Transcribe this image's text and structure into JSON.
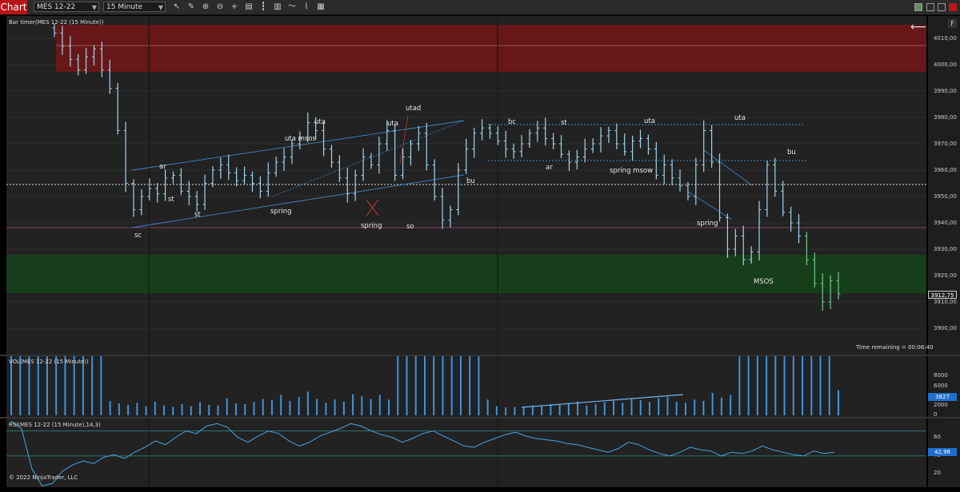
{
  "toolbar": {
    "chart_tab": "Chart",
    "instrument": "MES 12-22",
    "interval": "15 Minute",
    "icons": [
      "pointer-icon",
      "line-draw-icon",
      "zoom-in-icon",
      "zoom-out-icon",
      "crosshair-icon",
      "properties-icon",
      "chart-style-icon",
      "data-series-icon",
      "indicators-icon",
      "strategies-icon",
      "drawing-tools-icon"
    ]
  },
  "price_panel": {
    "title": "Bar timer(MES 12-22 (15 Minute))",
    "axis_labels": [
      "4010,00",
      "4000,00",
      "3990,00",
      "3980,00",
      "3970,00",
      "3960,00",
      "3950,00",
      "3940,00",
      "3930,00",
      "3920,00",
      "3910,00",
      "3900,00"
    ],
    "current_price": "3912,75",
    "time_remaining": "Time remaining = 00:06:40",
    "annotations": [
      "ar",
      "st",
      "st",
      "sc",
      "spring",
      "uta",
      "uta msos",
      "utad",
      "uta",
      "spring",
      "so",
      "bu",
      "bc",
      "st",
      "ar",
      "uta",
      "spring msow",
      "uta",
      "spring",
      "bu",
      "MSOS"
    ]
  },
  "volume_panel": {
    "title": "VOL(MES 12-22 (15 Minute))",
    "axis_labels": [
      "8000",
      "6000",
      "4000",
      "2000",
      "0"
    ],
    "current_value": "3827"
  },
  "rsi_panel": {
    "title": "RSI(MES 12-22 (15 Minute),14,3)",
    "axis_labels": [
      "60",
      "40",
      "20"
    ],
    "current_value": "42,98"
  },
  "footer": {
    "copyright": "© 2022 NinjaTrader, LLC"
  },
  "colors": {
    "supply_zone": "#6b1718",
    "demand_zone": "#16401b",
    "bar": "#9fd6ee",
    "volume": "#3a95e3",
    "rsi_line": "#4aa3df",
    "accent_red": "#b8141a"
  },
  "chart_data": {
    "type": "candlestick",
    "y_range": [
      3900,
      4015
    ],
    "close_trail": [
      4012,
      4007,
      4002,
      3998,
      4003,
      4006,
      3998,
      3991,
      3975,
      3955,
      3945,
      3950,
      3953,
      3951,
      3957,
      3958,
      3952,
      3950,
      3947,
      3955,
      3960,
      3962,
      3959,
      3956,
      3958,
      3955,
      3952,
      3959,
      3963,
      3965,
      3970,
      3972,
      3978,
      3975,
      3968,
      3963,
      3957,
      3951,
      3958,
      3965,
      3962,
      3970,
      3975,
      3958,
      3965,
      3970,
      3974,
      3962,
      3950,
      3941,
      3945,
      3960,
      3968,
      3974,
      3976,
      3974,
      3971,
      3968,
      3967,
      3970,
      3974,
      3976,
      3972,
      3970,
      3966,
      3963,
      3965,
      3968,
      3970,
      3973,
      3975,
      3970,
      3967,
      3971,
      3972,
      3968,
      3958,
      3962,
      3957,
      3954,
      3950,
      3962,
      3975,
      3963,
      3942,
      3930,
      3935,
      3926,
      3929,
      3945,
      3962,
      3952,
      3944,
      3940,
      3935,
      3926,
      3917,
      3910,
      3918,
      3913
    ],
    "volume": [
      9000,
      9000,
      9000,
      9000,
      9000,
      9000,
      9000,
      9000,
      9000,
      9000,
      9000,
      2200,
      1800,
      1600,
      1900,
      1400,
      2100,
      1500,
      1300,
      1700,
      1400,
      2000,
      1600,
      1500,
      2600,
      1800,
      1700,
      2000,
      2500,
      2300,
      3100,
      2200,
      2800,
      3600,
      2500,
      1900,
      2400,
      2100,
      3200,
      2900,
      2500,
      3100,
      2400,
      9000,
      9000,
      9000,
      9000,
      9000,
      9000,
      9000,
      9000,
      9000,
      9000,
      2400,
      1400,
      1200,
      1300,
      1200,
      1500,
      1400,
      1700,
      1600,
      1800,
      2100,
      1500,
      1700,
      2000,
      2200,
      1900,
      2500,
      2300,
      2000,
      2600,
      2800,
      2100,
      1900,
      2400,
      2200,
      3400,
      2700,
      3100,
      9000,
      9000,
      9000,
      9000,
      9000,
      9000,
      9000,
      9000,
      9000,
      9000,
      9000,
      3827
    ],
    "rsi_range": [
      15,
      70
    ],
    "rsi": [
      68,
      62,
      30,
      16,
      18,
      28,
      33,
      36,
      34,
      39,
      41,
      38,
      43,
      47,
      52,
      49,
      55,
      60,
      58,
      64,
      66,
      63,
      55,
      51,
      56,
      60,
      58,
      52,
      48,
      51,
      56,
      59,
      62,
      66,
      64,
      60,
      57,
      55,
      51,
      54,
      58,
      60,
      56,
      52,
      48,
      47,
      51,
      54,
      57,
      59,
      56,
      54,
      53,
      52,
      50,
      49,
      47,
      45,
      43,
      46,
      51,
      49,
      45,
      42,
      40,
      43,
      47,
      45,
      44,
      40,
      43,
      42,
      44,
      48,
      45,
      43,
      41,
      40,
      44,
      42,
      43
    ]
  }
}
